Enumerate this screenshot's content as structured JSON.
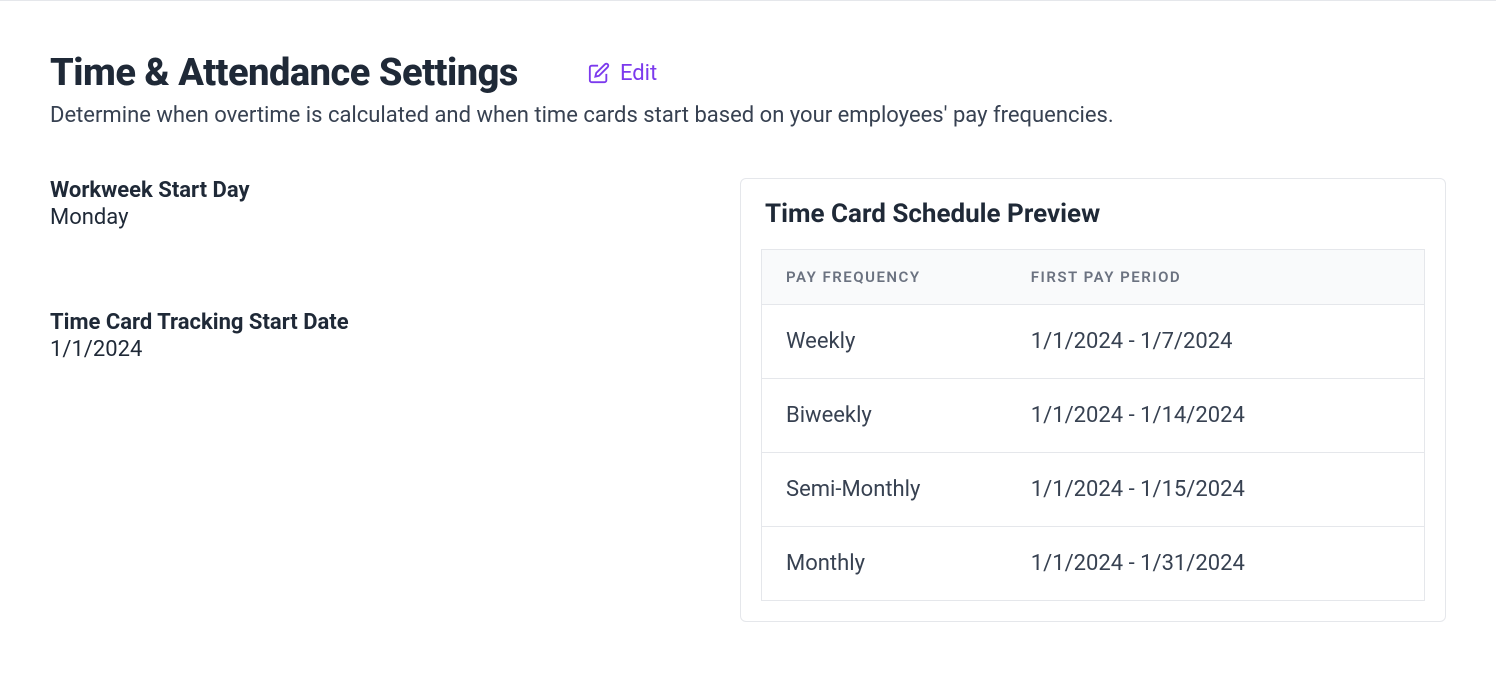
{
  "header": {
    "title": "Time & Attendance Settings",
    "edit_label": "Edit",
    "subtitle": "Determine when overtime is calculated and when time cards start based on your employees' pay frequencies."
  },
  "fields": {
    "workweek": {
      "label": "Workweek Start Day",
      "value": "Monday"
    },
    "tracking_start": {
      "label": "Time Card Tracking Start Date",
      "value": "1/1/2024"
    }
  },
  "preview": {
    "title": "Time Card Schedule Preview",
    "columns": {
      "pay_frequency": "Pay Frequency",
      "first_pay_period": "First Pay Period"
    },
    "rows": [
      {
        "pay_frequency": "Weekly",
        "first_pay_period": "1/1/2024 - 1/7/2024"
      },
      {
        "pay_frequency": "Biweekly",
        "first_pay_period": "1/1/2024 - 1/14/2024"
      },
      {
        "pay_frequency": "Semi-Monthly",
        "first_pay_period": "1/1/2024 - 1/15/2024"
      },
      {
        "pay_frequency": "Monthly",
        "first_pay_period": "1/1/2024 - 1/31/2024"
      }
    ]
  }
}
